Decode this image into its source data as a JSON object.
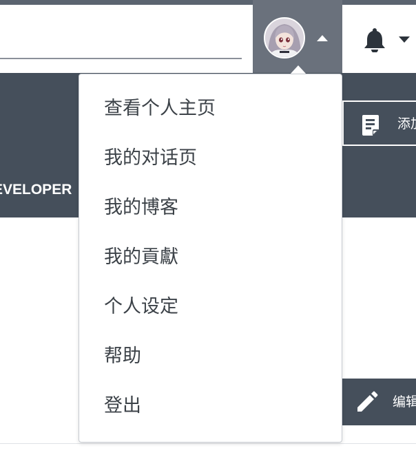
{
  "header": {
    "search": {
      "value": ""
    },
    "avatar_alt": "avatar",
    "notifications_icon": "bell-icon"
  },
  "banner": {
    "title": "EVELOPER",
    "add_button_label": "添加",
    "edit_button_label": "编辑"
  },
  "user_menu": {
    "items": [
      {
        "label": "查看个人主页",
        "icon": ""
      },
      {
        "label": "我的对话页",
        "icon": ""
      },
      {
        "label": "我的博客",
        "icon": ""
      },
      {
        "label": "我的貢獻",
        "icon": ""
      },
      {
        "label": "个人设定",
        "icon": ""
      },
      {
        "label": "帮助",
        "icon": ""
      },
      {
        "label": "登出",
        "icon": ""
      }
    ]
  },
  "colors": {
    "header_strip": "#5b6470",
    "avatar_trigger_active": "#6a717c",
    "banner": "#454f5b",
    "menu_text": "#3c4248",
    "menu_border": "#c7cbd1"
  }
}
